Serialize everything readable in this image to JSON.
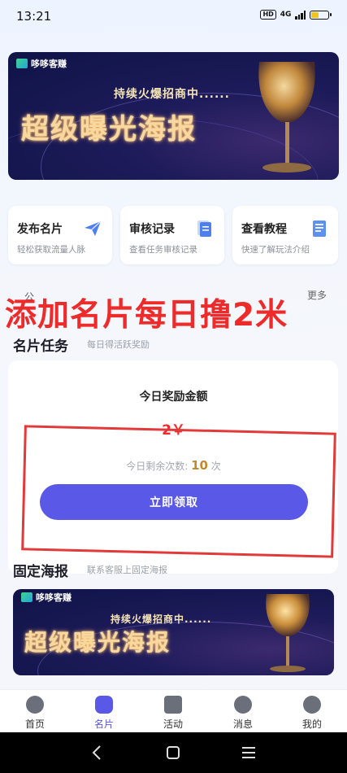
{
  "status_bar": {
    "time": "13:21",
    "network_badge": "HD",
    "network_type": "4G"
  },
  "top_banner": {
    "brand": "哆哆客赚",
    "subtitle": "持续火爆招商中......",
    "headline": "超级曝光海报"
  },
  "quick_cards": [
    {
      "title": "发布名片",
      "desc": "轻松获取流量人脉",
      "icon": "paper-plane-icon"
    },
    {
      "title": "审核记录",
      "desc": "查看任务审核记录",
      "icon": "document-icon"
    },
    {
      "title": "查看教程",
      "desc": "快速了解玩法介绍",
      "icon": "list-document-icon"
    }
  ],
  "overlay_text": "添加名片每日撸2米",
  "notice": {
    "left_partial": "公",
    "more": "更多"
  },
  "card_task_section": {
    "title": "名片任务",
    "subtitle": "每日得活跃奖励"
  },
  "reward_panel": {
    "title": "今日奖励金额",
    "amount": "2￥",
    "remaining_label": "今日剩余次数:",
    "remaining_count": "10",
    "remaining_unit": "次",
    "button": "立即领取"
  },
  "fixed_poster_section": {
    "title": "固定海报",
    "subtitle": "联系客服上固定海报"
  },
  "bottom_banner": {
    "brand": "哆哆客赚",
    "subtitle": "持续火爆招商中......",
    "headline": "超级曝光海报"
  },
  "tabs": [
    {
      "label": "首页",
      "icon": "home-icon",
      "active": false
    },
    {
      "label": "名片",
      "icon": "card-icon",
      "active": true
    },
    {
      "label": "活动",
      "icon": "activity-icon",
      "active": false
    },
    {
      "label": "消息",
      "icon": "bell-icon",
      "active": false
    },
    {
      "label": "我的",
      "icon": "user-icon",
      "active": false
    }
  ],
  "colors": {
    "accent": "#5a58e6",
    "overlay_red": "#ee2b2b",
    "banner_dark": "#1d1b5a",
    "gold": "#f7d9a0"
  }
}
